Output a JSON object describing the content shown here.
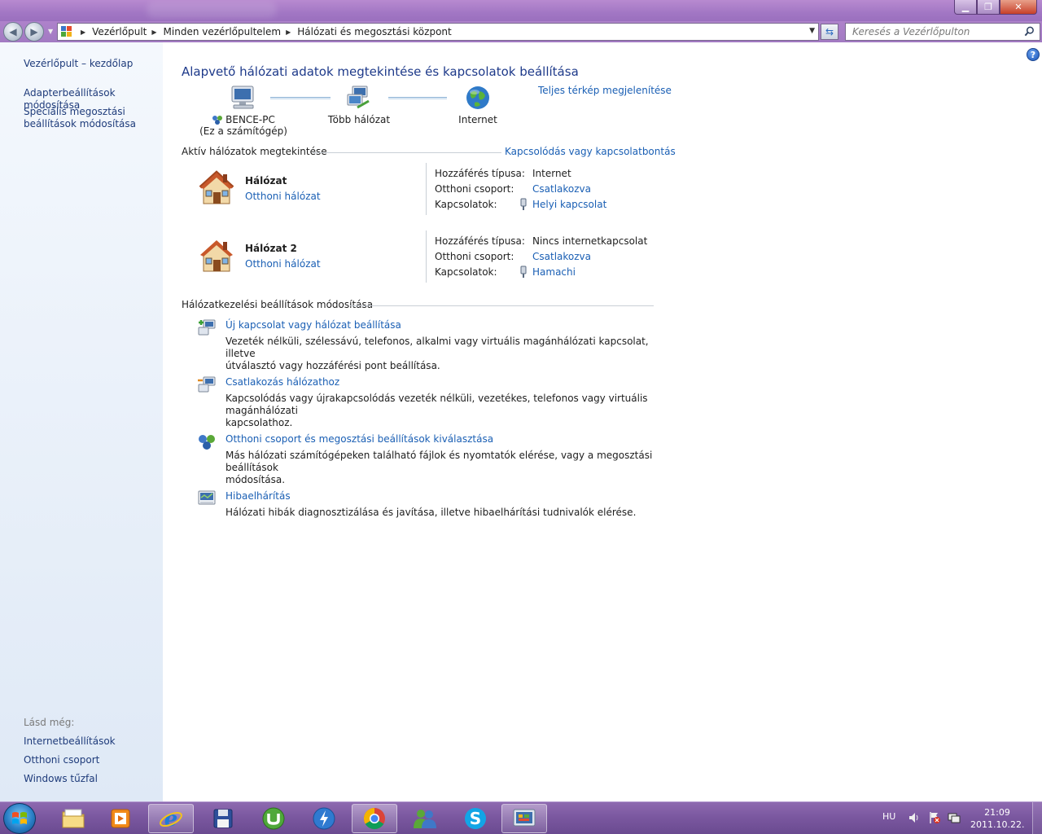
{
  "window": {
    "controls": [
      "minimize",
      "maximize",
      "close"
    ]
  },
  "address": {
    "segments": [
      "Vezérlőpult",
      "Minden vezérlőpultelem",
      "Hálózati és megosztási központ"
    ],
    "search_placeholder": "Keresés a Vezérlőpulton"
  },
  "sidebar": {
    "home": "Vezérlőpult – kezdőlap",
    "adapter": "Adapterbeállítások módosítása",
    "sharing_line1": "Speciális megosztási",
    "sharing_line2": "beállítások módosítása",
    "see_also": "Lásd még:",
    "internet_options": "Internetbeállítások",
    "homegroup": "Otthoni csoport",
    "firewall": "Windows tűzfal"
  },
  "main": {
    "title": "Alapvető hálózati adatok megtekintése és kapcsolatok beállítása",
    "full_map": "Teljes térkép megjelenítése",
    "map": {
      "pc_name": "BENCE-PC",
      "pc_note": "(Ez a számítógép)",
      "multi": "Több hálózat",
      "internet": "Internet"
    },
    "active_header": "Aktív hálózatok megtekintése",
    "connect_link": "Kapcsolódás vagy kapcsolatbontás",
    "networks": [
      {
        "name": "Hálózat",
        "type": "Otthoni hálózat",
        "access_label": "Hozzáférés típusa:",
        "access_value": "Internet",
        "homegroup_label": "Otthoni csoport:",
        "homegroup_value": "Csatlakozva",
        "conn_label": "Kapcsolatok:",
        "conn_value": "Helyi kapcsolat"
      },
      {
        "name": "Hálózat  2",
        "type": "Otthoni hálózat",
        "access_label": "Hozzáférés típusa:",
        "access_value": "Nincs internetkapcsolat",
        "homegroup_label": "Otthoni csoport:",
        "homegroup_value": "Csatlakozva",
        "conn_label": "Kapcsolatok:",
        "conn_value": "Hamachi"
      }
    ],
    "settings_header": "Hálózatkezelési beállítások módosítása",
    "tasks": [
      {
        "title": "Új kapcsolat vagy hálózat beállítása",
        "desc_line1": "Vezeték nélküli, szélessávú, telefonos, alkalmi vagy virtuális magánhálózati kapcsolat, illetve",
        "desc_line2": "útválasztó vagy hozzáférési pont beállítása."
      },
      {
        "title": "Csatlakozás hálózathoz",
        "desc_line1": "Kapcsolódás vagy újrakapcsolódás vezeték nélküli, vezetékes, telefonos vagy virtuális magánhálózati",
        "desc_line2": "kapcsolathoz."
      },
      {
        "title": "Otthoni csoport és megosztási beállítások kiválasztása",
        "desc_line1": "Más hálózati számítógépeken található fájlok és nyomtatók elérése, vagy a megosztási beállítások",
        "desc_line2": "módosítása."
      },
      {
        "title": "Hibaelhárítás",
        "desc_line1": "Hálózati hibák diagnosztizálása és javítása, illetve hibaelhárítási tudnivalók elérése.",
        "desc_line2": ""
      }
    ]
  },
  "taskbar": {
    "apps": [
      "explorer",
      "media-player",
      "internet-explorer",
      "save",
      "utorrent",
      "thunder",
      "chrome",
      "messenger",
      "skype",
      "control-panel"
    ],
    "language": "HU",
    "time": "21:09",
    "date": "2011.10.22."
  },
  "colors": {
    "link": "#1a5fb4",
    "title": "#1e3a8a",
    "sidebar_link": "#1e3b7a",
    "titlebar": "#a277c4"
  }
}
